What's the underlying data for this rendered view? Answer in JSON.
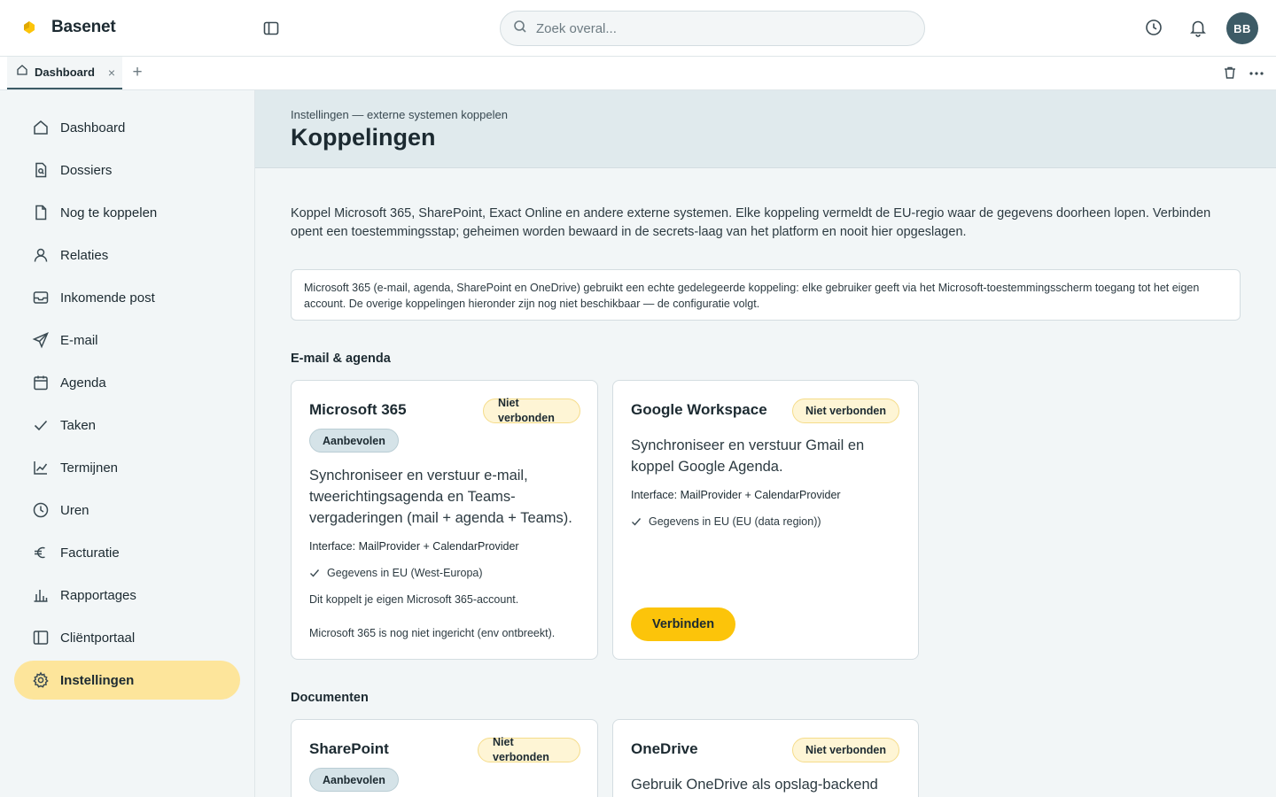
{
  "app": {
    "brand": "Basenet"
  },
  "search": {
    "placeholder": "Zoek overal..."
  },
  "user": {
    "initials": "BB"
  },
  "tabs": [
    {
      "label": "Dashboard",
      "close": "×"
    }
  ],
  "tab_add": "+",
  "sidebar": {
    "items": [
      {
        "label": "Dashboard",
        "icon": "home-icon"
      },
      {
        "label": "Dossiers",
        "icon": "file-search-icon"
      },
      {
        "label": "Nog te koppelen",
        "icon": "file-icon"
      },
      {
        "label": "Relaties",
        "icon": "user-icon"
      },
      {
        "label": "Inkomende post",
        "icon": "inbox-icon"
      },
      {
        "label": "E-mail",
        "icon": "send-icon"
      },
      {
        "label": "Agenda",
        "icon": "calendar-icon"
      },
      {
        "label": "Taken",
        "icon": "check-icon"
      },
      {
        "label": "Termijnen",
        "icon": "line-chart-icon"
      },
      {
        "label": "Uren",
        "icon": "clock-icon"
      },
      {
        "label": "Facturatie",
        "icon": "euro-icon"
      },
      {
        "label": "Rapportages",
        "icon": "bar-chart-icon"
      },
      {
        "label": "Cliëntportaal",
        "icon": "panel-icon"
      },
      {
        "label": "Instellingen",
        "icon": "gear-icon",
        "active": true
      }
    ]
  },
  "header": {
    "breadcrumb": "Instellingen — externe systemen koppelen",
    "title": "Koppelingen"
  },
  "intro": "Koppel Microsoft 365, SharePoint, Exact Online en andere externe systemen. Elke koppeling vermeldt de EU-regio waar de gegevens doorheen lopen. Verbinden opent een toestemmingsstap; geheimen worden bewaard in de secrets-laag van het platform en nooit hier opgeslagen.",
  "notice": "Microsoft 365 (e-mail, agenda, SharePoint en OneDrive) gebruikt een echte gedelegeerde koppeling: elke gebruiker geeft via het Microsoft-toestemmingsscherm toegang tot het eigen account. De overige koppelingen hieronder zijn nog niet beschikbaar — de configuratie volgt.",
  "sections": [
    {
      "title": "E-mail & agenda",
      "cards": [
        {
          "name": "Microsoft 365",
          "status": "Niet verbonden",
          "badge": "Aanbevolen",
          "description": "Synchroniseer en verstuur e-mail, tweerichtingsagenda en Teams-vergaderingen (mail + agenda + Teams).",
          "interface": "Interface: MailProvider + CalendarProvider",
          "eu": "Gegevens in EU (West-Europa)",
          "note1": "Dit koppelt je eigen Microsoft 365-account.",
          "note2": "Microsoft 365 is nog niet ingericht (env ontbreekt)."
        },
        {
          "name": "Google Workspace",
          "status": "Niet verbonden",
          "description": "Synchroniseer en verstuur Gmail en koppel Google Agenda.",
          "interface": "Interface: MailProvider + CalendarProvider",
          "eu": "Gegevens in EU (EU (data region))",
          "action": "Verbinden"
        }
      ]
    },
    {
      "title": "Documenten",
      "cards": [
        {
          "name": "SharePoint",
          "status": "Niet verbonden",
          "badge": "Aanbevolen"
        },
        {
          "name": "OneDrive",
          "status": "Niet verbonden",
          "description": "Gebruik OneDrive als opslag-backend"
        }
      ]
    }
  ],
  "colors": {
    "accent_yellow": "#fcc40a",
    "active_nav": "#fde59b",
    "avatar": "#3d5b66",
    "header_band": "#e0eaed"
  }
}
